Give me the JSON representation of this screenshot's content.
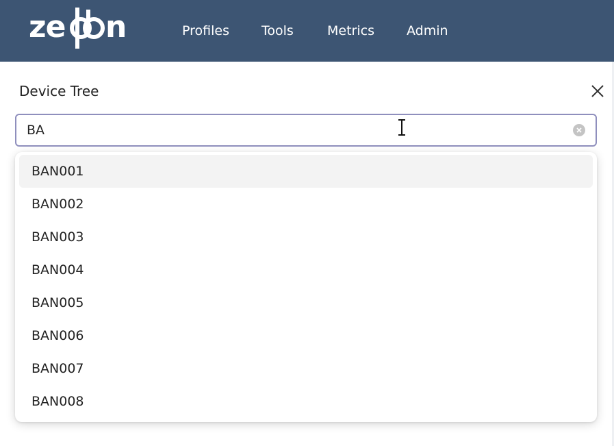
{
  "header": {
    "logo_text": "zeppen",
    "nav": [
      {
        "label": "Profiles"
      },
      {
        "label": "Tools"
      },
      {
        "label": "Metrics"
      },
      {
        "label": "Admin"
      }
    ]
  },
  "panel": {
    "title": "Device Tree",
    "close_icon": "close-icon"
  },
  "search": {
    "value": "BA",
    "clear_icon": "clear-circle-icon"
  },
  "dropdown": {
    "options": [
      {
        "label": "BAN001",
        "highlighted": true
      },
      {
        "label": "BAN002"
      },
      {
        "label": "BAN003"
      },
      {
        "label": "BAN004"
      },
      {
        "label": "BAN005"
      },
      {
        "label": "BAN006"
      },
      {
        "label": "BAN007"
      },
      {
        "label": "BAN008"
      }
    ]
  },
  "colors": {
    "navbar": "#3d5573",
    "input_border": "#8f8fbd",
    "highlight": "#f3f3f3"
  }
}
